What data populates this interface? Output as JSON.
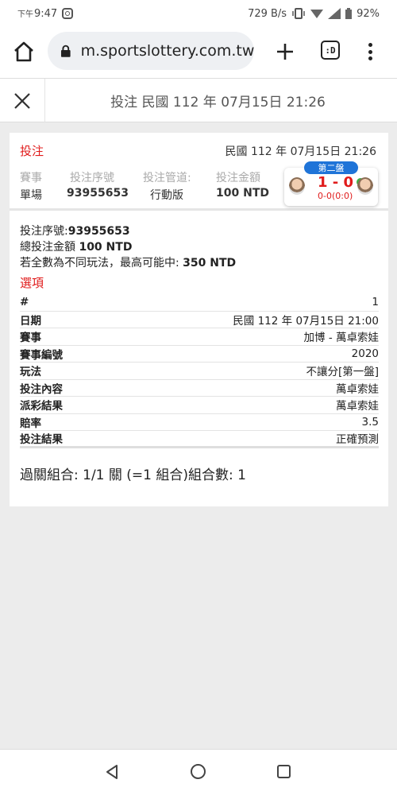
{
  "status_bar": {
    "time_prefix": "下午",
    "time": "9:47",
    "net_speed": "729 B/s",
    "battery": "92%"
  },
  "browser": {
    "url": "m.sportslottery.com.tw/",
    "tabs_label": ":D"
  },
  "header": {
    "title": "投注 民國 112 年 07月15日 21:26"
  },
  "bet": {
    "type_label": "投注",
    "date": "民國 112 年 07月15日 21:26",
    "columns": [
      {
        "header": "賽事",
        "value": "單場"
      },
      {
        "header": "投注序號",
        "value": "93955653"
      },
      {
        "header": "投注管道:",
        "value": "行動版"
      },
      {
        "header": "投注金額",
        "value": "100 NTD"
      }
    ],
    "score": {
      "badge": "第二盤",
      "main": "1 - 0",
      "sub": "0-0(0:0)"
    },
    "info": {
      "serial_label": "投注序號:",
      "serial_value": "93955653",
      "amount_label": "總投注金額 ",
      "amount_value": "100 NTD",
      "max_label": "若全數為不同玩法，最高可能中: ",
      "max_value": "350 NTD"
    },
    "options_label": "選項",
    "details": [
      {
        "k": "#",
        "v": "1"
      },
      {
        "k": "日期",
        "v": "民國 112 年 07月15日 21:00"
      },
      {
        "k": "賽事",
        "v": "加博 - 萬卓索娃"
      },
      {
        "k": "賽事編號",
        "v": "2020"
      },
      {
        "k": "玩法",
        "v": "不讓分[第一盤]"
      },
      {
        "k": "投注內容",
        "v": "萬卓索娃"
      },
      {
        "k": "派彩結果",
        "v": "萬卓索娃"
      },
      {
        "k": "賠率",
        "v": "3.5"
      },
      {
        "k": "投注結果",
        "v": "正確預測"
      }
    ],
    "summary": "過關組合: 1/1 關 (=1 組合)組合數: 1"
  }
}
